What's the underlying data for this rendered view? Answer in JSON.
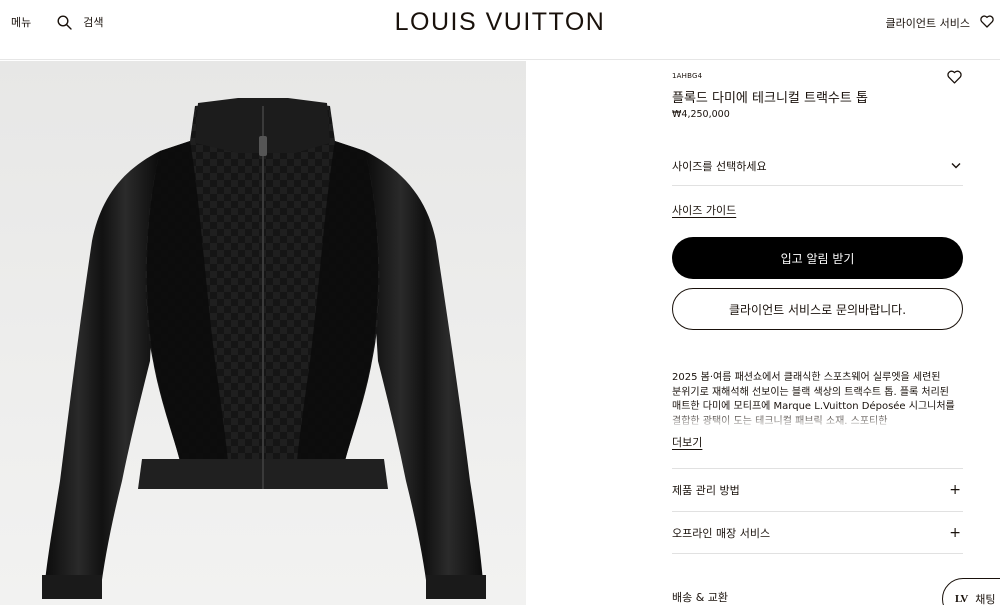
{
  "header": {
    "menu_label": "메뉴",
    "search_label": "검색",
    "logo": "LOUIS VUITTON",
    "client_service_label": "클라이언트 서비스"
  },
  "product": {
    "sku": "1AHBG4",
    "name": "플록드 다미에 테크니컬 트랙수트 톱",
    "price": "₩4,250,000",
    "size_select_label": "사이즈를 선택하세요",
    "size_guide_label": "사이즈 가이드",
    "primary_button": "입고 알림 받기",
    "secondary_button": "클라이언트 서비스로 문의바랍니다.",
    "description": "2025 봄·여름 패션쇼에서 클래식한 스포츠웨어 실루엣을 세련된 분위기로 재해석해 선보이는 블랙 색상의 트랙수트 톱. 플록 처리된 매트한 다미에 모티프에 Marque L.Vuitton Déposée 시그니처를 결합한 광택이 도는 테크니컬 패브릭 소재. 스포티한",
    "more_label": "더보기",
    "accordions": [
      "제품 관리 방법",
      "오프라인 매장 서비스"
    ],
    "shipping_label": "배송 & 교환"
  },
  "chat": {
    "monogram": "LV",
    "label": "채팅"
  },
  "icons": {
    "search": "search-icon",
    "wishlist": "heart-icon",
    "chevron": "chevron-down-icon",
    "expand": "plus-icon"
  },
  "colors": {
    "text": "#19110b",
    "button_primary": "#000000",
    "image_bg": "#ebebea",
    "divider": "#e1e1e1"
  }
}
